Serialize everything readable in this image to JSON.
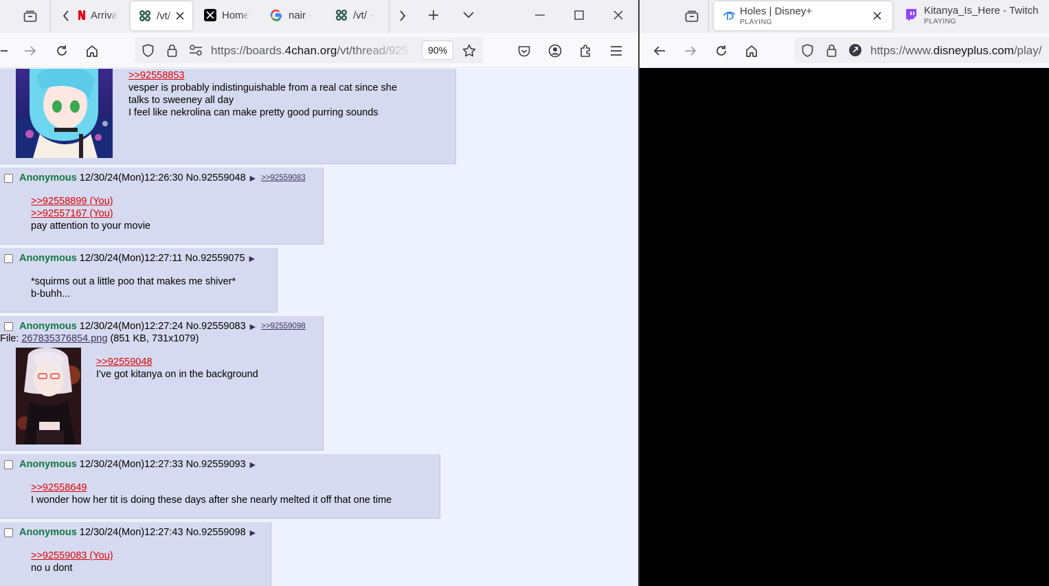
{
  "left_window": {
    "tabs": [
      {
        "title": "Arriva",
        "icon": "netflix-icon"
      },
      {
        "title": "/vt/",
        "icon": "4chan-clover-icon",
        "active": true
      },
      {
        "title": "Home",
        "icon": "x-logo-icon"
      },
      {
        "title": "nair -",
        "icon": "google-icon"
      },
      {
        "title": "/vt/ -",
        "icon": "4chan-clover-icon"
      }
    ],
    "url": {
      "prefix": "https://boards.",
      "domain": "4chan.org",
      "path": "/vt/thread/925"
    },
    "zoom": "90%"
  },
  "right_window": {
    "tabs": [
      {
        "title": "Holes | Disney+",
        "status": "PLAYING",
        "icon": "disney-plus-icon",
        "active": true
      },
      {
        "title": "Kitanya_Is_Here - Twitch",
        "status": "PLAYING",
        "icon": "twitch-icon"
      }
    ],
    "url": {
      "prefix": "https://www.",
      "domain": "disneyplus.com",
      "path": "/play/"
    }
  },
  "thread": {
    "posts": [
      {
        "quotes": [
          ">>92558853"
        ],
        "lines": [
          "vesper is probably indistinguishable from a real cat since she",
          "talks to sweeney all day",
          "I feel like nekrolina can make pretty good purring sounds"
        ]
      },
      {
        "name": "Anonymous",
        "datetime": "12/30/24(Mon)12:26:30",
        "no": "No.92559048",
        "backlink": ">>92559083",
        "quotes": [
          ">>92558899 (You)",
          ">>92557167 (You)"
        ],
        "lines": [
          "pay attention to your movie"
        ]
      },
      {
        "name": "Anonymous",
        "datetime": "12/30/24(Mon)12:27:11",
        "no": "No.92559075",
        "lines": [
          "*squirms out a little poo that makes me shiver*",
          "b-buhh..."
        ]
      },
      {
        "name": "Anonymous",
        "datetime": "12/30/24(Mon)12:27:24",
        "no": "No.92559083",
        "backlink": ">>92559098",
        "file_label": "File: ",
        "file_name": "267835376854.png",
        "file_meta": " (851 KB, 731x1079)",
        "quotes": [
          ">>92559048"
        ],
        "lines": [
          "I've got kitanya on in the background"
        ]
      },
      {
        "name": "Anonymous",
        "datetime": "12/30/24(Mon)12:27:33",
        "no": "No.92559093",
        "quotes": [
          ">>92558649"
        ],
        "lines": [
          "I wonder how her tit is doing these days after she nearly melted it off that one time"
        ]
      },
      {
        "name": "Anonymous",
        "datetime": "12/30/24(Mon)12:27:43",
        "no": "No.92559098",
        "quotes": [
          ">>92559083 (You)"
        ],
        "lines": [
          "no u dont"
        ]
      }
    ]
  },
  "colors": {
    "reply_bg": "#d6daf0",
    "page_bg": "#eef2ff",
    "name": "#117743",
    "quotelink": "#dd0000"
  }
}
